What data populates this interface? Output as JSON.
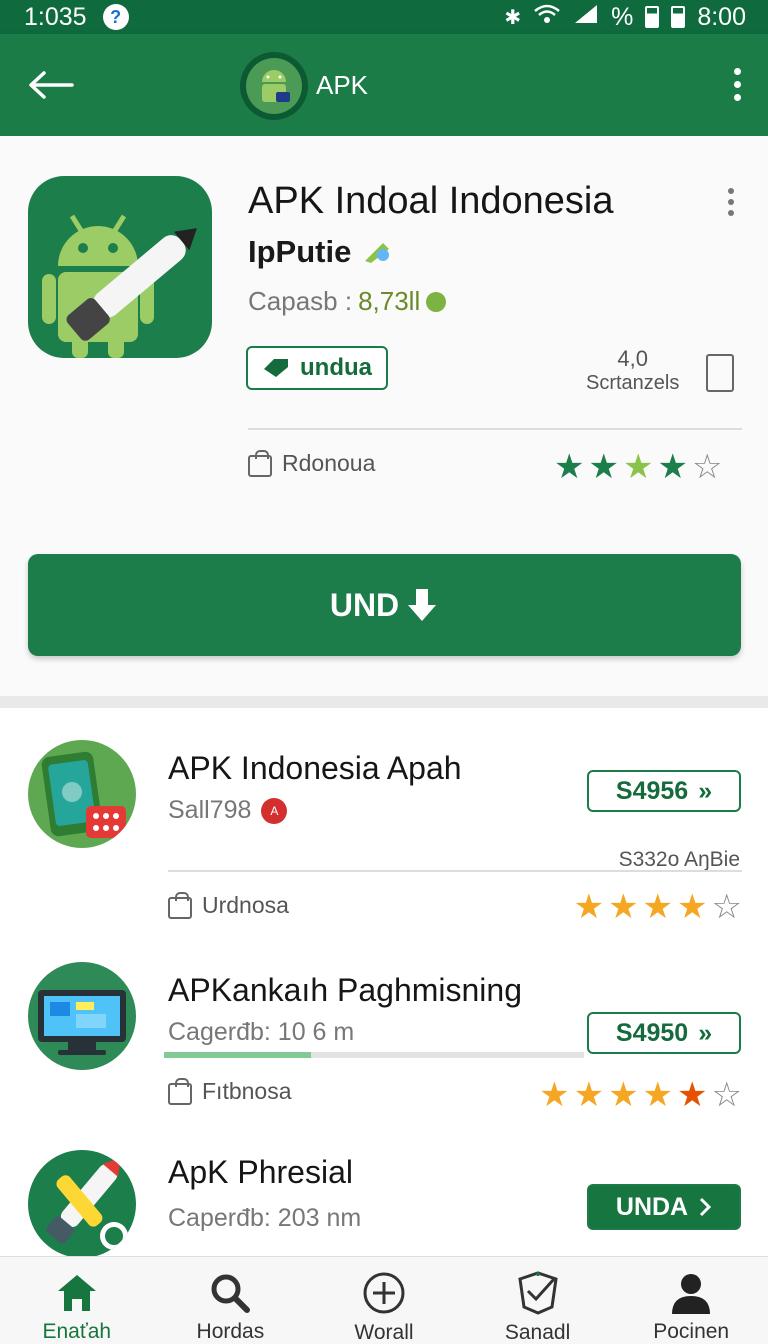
{
  "status_bar": {
    "time": "1:03",
    "percent": "%",
    "clock": "8:00"
  },
  "app_bar": {
    "title": "APK"
  },
  "hero": {
    "title": "APK Indoal  Indonesia",
    "subtitle": "IpPutie",
    "size_label": "Capasb :",
    "size_value": "8,73ll",
    "chip_label": "undua",
    "rating_value": "4,0",
    "rating_label": "Scrtanzels",
    "category": "Rdonoua",
    "stars": [
      {
        "char": "★",
        "color": "#1c7e4a"
      },
      {
        "char": "★",
        "color": "#1c7e4a"
      },
      {
        "char": "★",
        "color": "#8bc34a"
      },
      {
        "char": "★",
        "color": "#1c7e4a"
      },
      {
        "char": "☆",
        "color": "#888888"
      }
    ],
    "install_label": "UND"
  },
  "list": [
    {
      "title": "APK Indonesia Apah",
      "subtitle": "Sall798",
      "price": "S4956",
      "meta": "S332o AŋBie",
      "category": "Urdnosa",
      "stars": [
        {
          "char": "★",
          "color": "#f5a623"
        },
        {
          "char": "★",
          "color": "#f5a623"
        },
        {
          "char": "★",
          "color": "#f5a623"
        },
        {
          "char": "★",
          "color": "#f5a623"
        },
        {
          "char": "☆",
          "color": "#888888"
        }
      ]
    },
    {
      "title": "APKankaıh Paghmisning",
      "subtitle": "Cagerđb: 10 6 m",
      "price": "S4950",
      "category": "Fıtbnosa",
      "progress": 0.35,
      "stars": [
        {
          "char": "★",
          "color": "#f5a623"
        },
        {
          "char": "★",
          "color": "#f5a623"
        },
        {
          "char": "★",
          "color": "#f5a623"
        },
        {
          "char": "★",
          "color": "#f5a623"
        },
        {
          "char": "★",
          "color": "#e65100"
        },
        {
          "char": "☆",
          "color": "#888888"
        }
      ]
    },
    {
      "title": "ApK Phresial",
      "subtitle": "Caperđb: 203 nm",
      "button": "UNDA"
    }
  ],
  "bottom_nav": [
    {
      "label": "Enaťah",
      "icon": "home-icon"
    },
    {
      "label": "Hordas",
      "icon": "search-icon"
    },
    {
      "label": "Worall",
      "icon": "add-circle-icon"
    },
    {
      "label": "Sanadl",
      "icon": "shield-check-icon"
    },
    {
      "label": "Pocinen",
      "icon": "person-icon"
    }
  ],
  "colors": {
    "primary": "#1b7c47",
    "status_bar": "#0f6a3e",
    "star_gold": "#f5a623"
  }
}
